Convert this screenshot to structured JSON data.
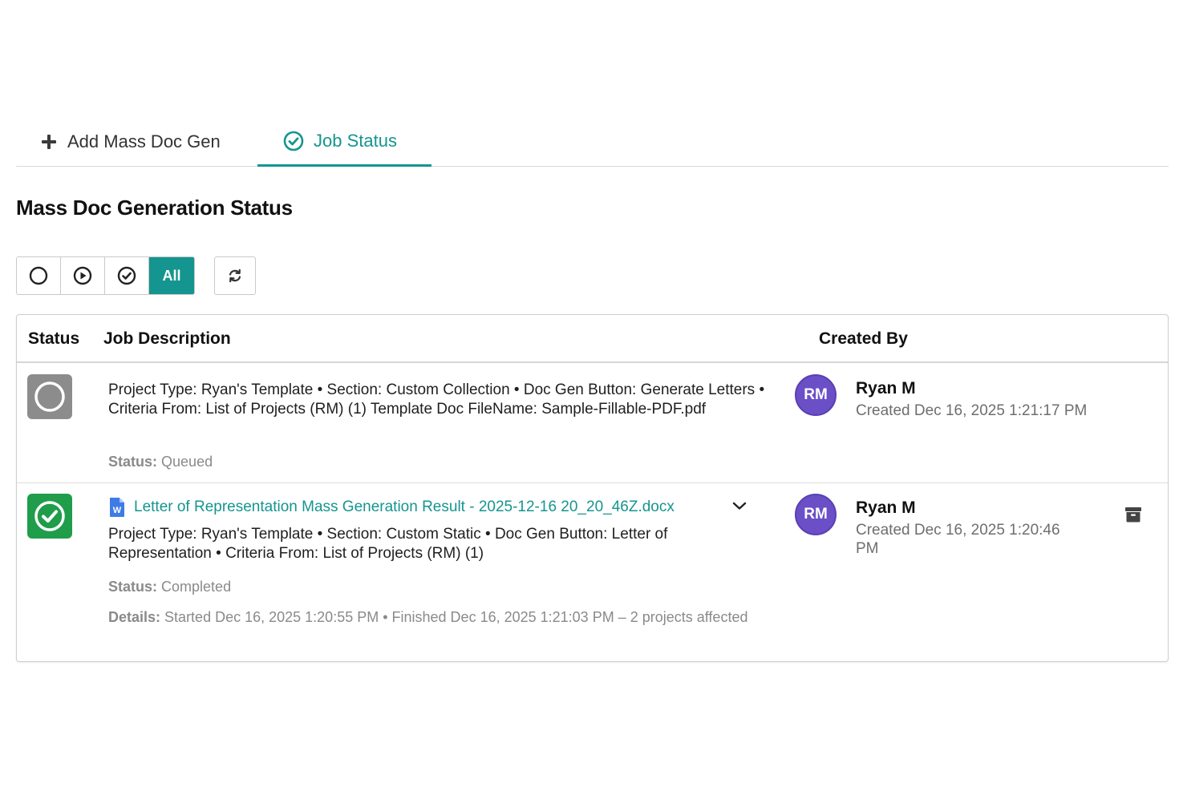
{
  "colors": {
    "accent": "#15958f",
    "queued_gray": "#8c8c8c",
    "completed_green": "#1f9d4a",
    "avatar_purple": "#6b4fc7"
  },
  "tabs": [
    {
      "label": "Add Mass Doc Gen",
      "icon": "plus-icon",
      "active": false
    },
    {
      "label": "Job Status",
      "icon": "check-circle-icon",
      "active": true
    }
  ],
  "page_title": "Mass Doc Generation Status",
  "filters": [
    {
      "icon": "circle-outline-icon",
      "label": "",
      "active": false
    },
    {
      "icon": "play-circle-icon",
      "label": "",
      "active": false
    },
    {
      "icon": "check-circle-icon",
      "label": "",
      "active": false
    },
    {
      "icon": "",
      "label": "All",
      "active": true
    }
  ],
  "refresh_icon": "refresh-icon",
  "table": {
    "headers": {
      "status": "Status",
      "description": "Job Description",
      "created_by": "Created By"
    },
    "rows": [
      {
        "status_icon": "queued-circle-icon",
        "description": "Project Type: Ryan's Template • Section: Custom Collection • Doc Gen Button: Generate Letters • Criteria From: List of Projects (RM) (1) Template Doc FileName: Sample-Fillable-PDF.pdf",
        "status_label": "Status:",
        "status_value": "Queued",
        "avatar_initials": "RM",
        "creator_name": "Ryan M",
        "created_at": "Created Dec 16, 2025 1:21:17 PM"
      },
      {
        "status_icon": "completed-check-icon",
        "doc_link": "Letter of Representation Mass Generation Result - 2025-12-16 20_20_46Z.docx",
        "description": "Project Type: Ryan's Template • Section: Custom Static • Doc Gen Button: Letter of Representation • Criteria From: List of Projects (RM) (1)",
        "status_label": "Status:",
        "status_value": "Completed",
        "details_label": "Details:",
        "details_value": "Started Dec 16, 2025 1:20:55 PM  •  Finished Dec 16, 2025 1:21:03 PM – 2 projects affected",
        "avatar_initials": "RM",
        "creator_name": "Ryan M",
        "created_at": "Created Dec 16, 2025 1:20:46 PM",
        "archive_icon": "archive-icon"
      }
    ]
  }
}
